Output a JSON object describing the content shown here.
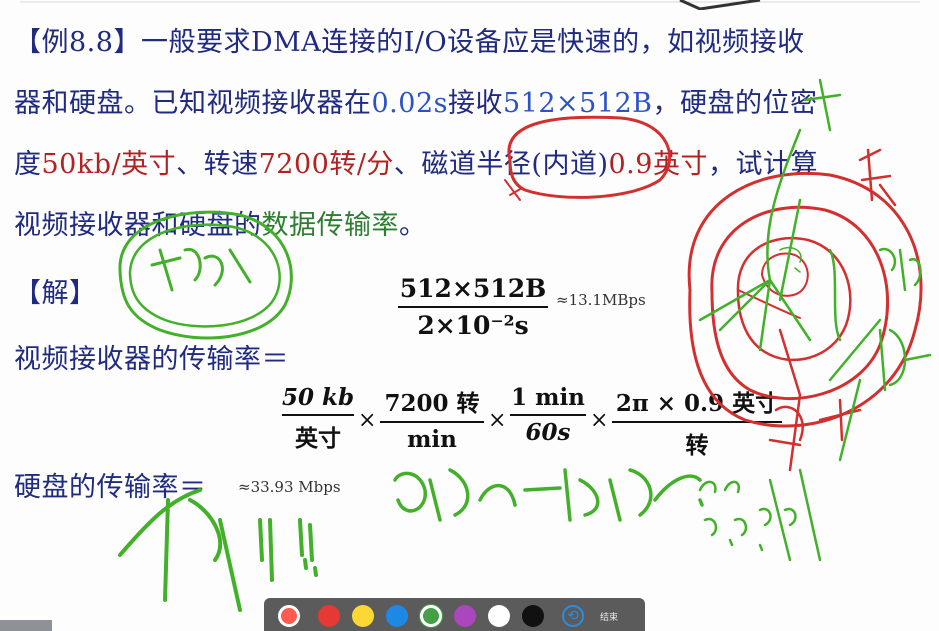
{
  "problem": {
    "tag": "【例8.8】",
    "line1_rest": "一般要求DMA连接的I/O设备应是快速的，如视频接收",
    "line2_a": "器和硬盘。已知视频接收器在",
    "line2_b": "0.02s",
    "line2_c": "接收",
    "line2_d": "512×512B",
    "line2_e": "，硬盘的位密",
    "line3_a": "度",
    "line3_b": "50kb/英寸",
    "line3_c": "、转速",
    "line3_d": "7200转/分",
    "line3_e": "、磁道半径(内道)",
    "line3_f": "0.9英寸",
    "line3_g": "，试计算",
    "line4_a": "视频接收器和硬盘的",
    "line4_b": "数据传输率",
    "line4_c": "。"
  },
  "solution": {
    "label": "【解】",
    "video_label": "视频接收器的传输率＝",
    "disk_label": "硬盘的传输率＝",
    "frac1_num": "512×512B",
    "frac1_den": "2×10⁻²s",
    "approx1": "≈13.1MBps",
    "f_a_num": "50 kb",
    "f_a_den": "英寸",
    "f_b_num": "7200 转",
    "f_b_den": "min",
    "f_c_num": "1 min",
    "f_c_den": "60s",
    "f_d_num": "2π × 0.9 英寸",
    "f_d_den": "转",
    "times": "×",
    "approx2": "≈33.93 Mbps"
  },
  "toolbar": {
    "pen_colors": [
      "#e53935",
      "#fdd835",
      "#1e88e5",
      "#43a047",
      "#ab47bc",
      "#ffffff",
      "#111111"
    ],
    "undo_label": "⟲",
    "end_label": "结束"
  }
}
